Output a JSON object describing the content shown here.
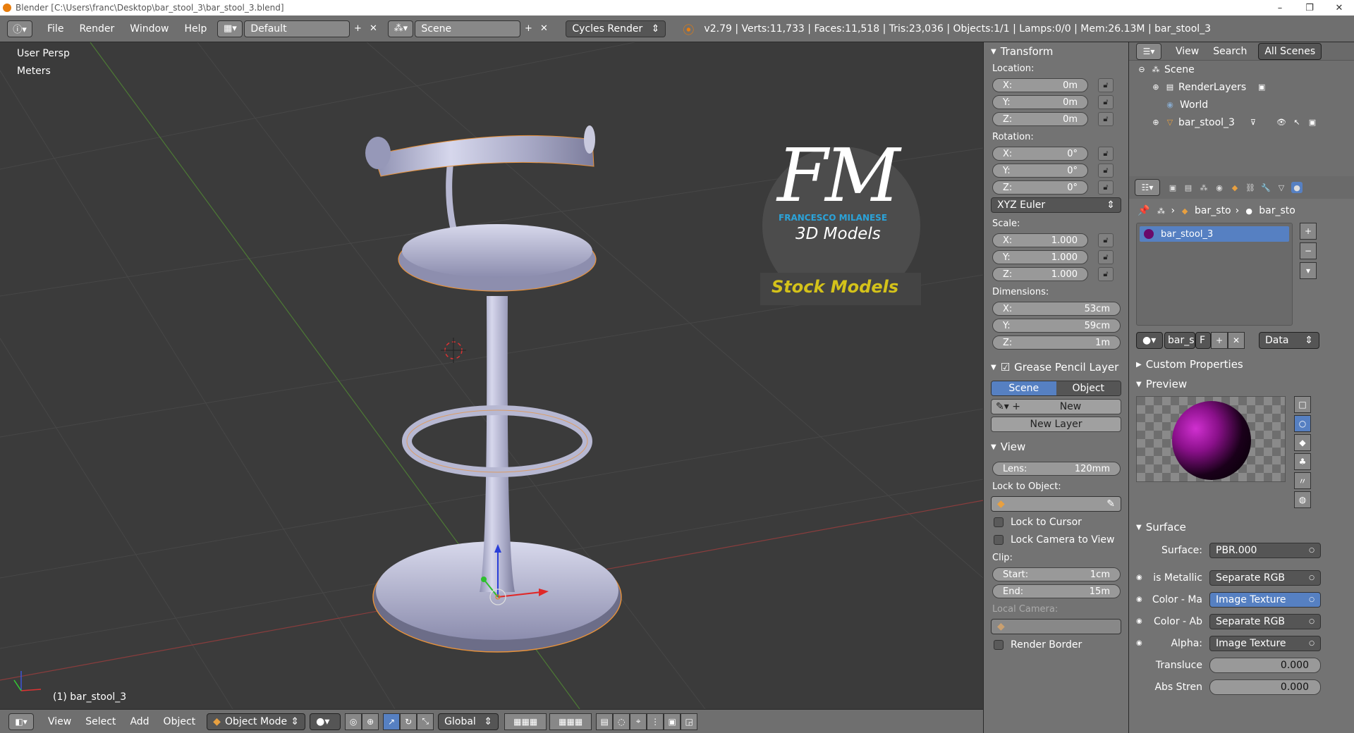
{
  "window": {
    "title": "Blender [C:\\Users\\franc\\Desktop\\bar_stool_3\\bar_stool_3.blend]",
    "min": "–",
    "max": "❐",
    "close": "✕"
  },
  "info": {
    "menus": [
      "File",
      "Render",
      "Window",
      "Help"
    ],
    "layout": "Default",
    "scene": "Scene",
    "engine": "Cycles Render",
    "stats": "v2.79 | Verts:11,733 | Faces:11,518 | Tris:23,036 | Objects:1/1 | Lamps:0/0 | Mem:26.13M | bar_stool_3"
  },
  "viewport": {
    "view_name": "User Persp",
    "units": "Meters",
    "object_label": "(1) bar_stool_3",
    "logo_letters": "FM",
    "logo_name": "FRANCESCO MILANESE",
    "logo_sub": "3D Models",
    "logo_badge": "Stock Models"
  },
  "bottom": {
    "menus": [
      "View",
      "Select",
      "Add",
      "Object"
    ],
    "mode": "Object Mode",
    "orientation": "Global"
  },
  "transform": {
    "header": "Transform",
    "location_label": "Location:",
    "location": [
      {
        "axis": "X:",
        "value": "0m"
      },
      {
        "axis": "Y:",
        "value": "0m"
      },
      {
        "axis": "Z:",
        "value": "0m"
      }
    ],
    "rotation_label": "Rotation:",
    "rotation": [
      {
        "axis": "X:",
        "value": "0°"
      },
      {
        "axis": "Y:",
        "value": "0°"
      },
      {
        "axis": "Z:",
        "value": "0°"
      }
    ],
    "rotation_mode": "XYZ Euler",
    "scale_label": "Scale:",
    "scale": [
      {
        "axis": "X:",
        "value": "1.000"
      },
      {
        "axis": "Y:",
        "value": "1.000"
      },
      {
        "axis": "Z:",
        "value": "1.000"
      }
    ],
    "dimensions_label": "Dimensions:",
    "dimensions": [
      {
        "axis": "X:",
        "value": "53cm"
      },
      {
        "axis": "Y:",
        "value": "59cm"
      },
      {
        "axis": "Z:",
        "value": "1m"
      }
    ]
  },
  "grease": {
    "header": "Grease Pencil Layer",
    "scene_tab": "Scene",
    "object_tab": "Object",
    "new": "New",
    "new_layer": "New Layer"
  },
  "viewpanel": {
    "header": "View",
    "lens_label": "Lens:",
    "lens": "120mm",
    "lock_object": "Lock to Object:",
    "lock_cursor": "Lock to Cursor",
    "lock_camera": "Lock Camera to View",
    "clip": "Clip:",
    "start_label": "Start:",
    "start": "1cm",
    "end_label": "End:",
    "end": "15m",
    "local_camera": "Local Camera:",
    "render_border": "Render Border"
  },
  "outliner": {
    "view": "View",
    "search": "Search",
    "filter": "All Scenes",
    "items": [
      "Scene",
      "RenderLayers",
      "World",
      "bar_stool_3"
    ]
  },
  "props": {
    "crumb1": "bar_sto",
    "crumb2": "bar_sto",
    "slot": "bar_stool_3",
    "mat_short": "bar_s",
    "mat_f": "F",
    "data": "Data",
    "custom": "Custom Properties",
    "preview": "Preview",
    "surface_header": "Surface",
    "rows": [
      {
        "label": "Surface:",
        "value": "PBR.000",
        "kind": "drop"
      },
      {
        "label": "is Metallic",
        "value": "Separate RGB",
        "kind": "drop"
      },
      {
        "label": "Color - Ma",
        "value": "Image Texture",
        "kind": "blue"
      },
      {
        "label": "Color - Ab",
        "value": "Separate RGB",
        "kind": "drop"
      },
      {
        "label": "Alpha:",
        "value": "Image Texture",
        "kind": "drop"
      },
      {
        "label": "Transluce",
        "value": "0.000",
        "kind": "slider"
      },
      {
        "label": "Abs Stren",
        "value": "0.000",
        "kind": "slider"
      }
    ]
  },
  "colors": {
    "accent": "#5680c2",
    "origin": "#e87d0d",
    "badge_text": "#d4c21a",
    "logo_blue": "#2ba3d9"
  }
}
